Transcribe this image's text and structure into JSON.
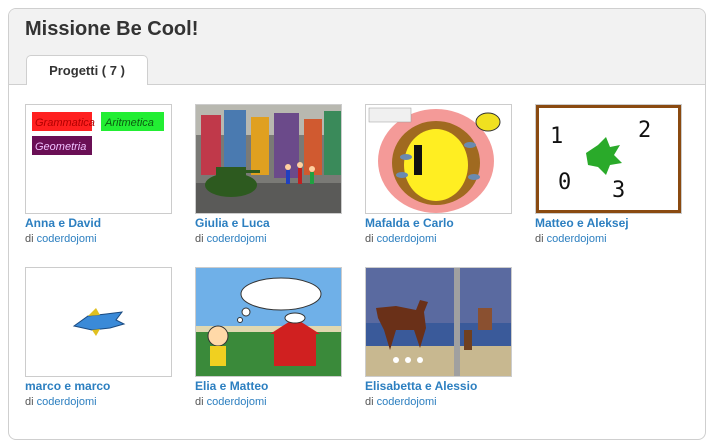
{
  "page": {
    "title": "Missione Be Cool!"
  },
  "tabs": [
    {
      "label": "Progetti ( 7 )"
    }
  ],
  "projects": [
    {
      "title": "Anna e David",
      "by_prefix": "di",
      "author": "coderdojomi",
      "thumb_labels": [
        "Grammatica",
        "Aritmetica",
        "Geometria"
      ]
    },
    {
      "title": "Giulia e Luca",
      "by_prefix": "di",
      "author": "coderdojomi"
    },
    {
      "title": "Mafalda e Carlo",
      "by_prefix": "di",
      "author": "coderdojomi"
    },
    {
      "title": "Matteo e Aleksej",
      "by_prefix": "di",
      "author": "coderdojomi",
      "thumb_labels": [
        "1",
        "2",
        "0",
        "3"
      ]
    },
    {
      "title": "marco e marco",
      "by_prefix": "di",
      "author": "coderdojomi"
    },
    {
      "title": "Elia e Matteo",
      "by_prefix": "di",
      "author": "coderdojomi"
    },
    {
      "title": "Elisabetta e Alessio",
      "by_prefix": "di",
      "author": "coderdojomi"
    }
  ],
  "colors": {
    "link": "#2c7fc0",
    "header_bg": "#f2f2f2",
    "title": "#333333"
  }
}
